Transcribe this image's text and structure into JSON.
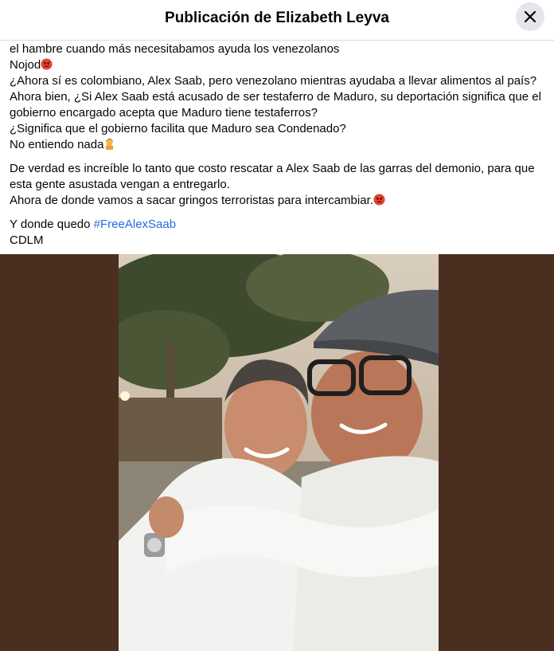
{
  "header": {
    "title": "Publicación de Elizabeth Leyva",
    "close_icon": "close-icon"
  },
  "post": {
    "lines1": [
      "el hambre cuando más necesitabamos ayuda los venezolanos",
      "Nojod",
      "¿Ahora sí es colombiano, Alex Saab, pero venezolano mientras ayudaba a llevar alimentos al país?",
      "Ahora bien, ¿Si Alex Saab está acusado de ser testaferro de Maduro, su deportación significa que el gobierno encargado acepta que Maduro tiene testaferros?",
      "¿Significa que el gobierno facilita que Maduro sea Condenado?",
      "No entiendo nada"
    ],
    "lines2": [
      "De verdad es increíble lo tanto que costo rescatar a Alex Saab de las garras del demonio, para que esta gente asustada vengan a entregarlo.",
      "Ahora de donde vamos a sacar gringos terroristas para intercambiar."
    ],
    "closing_prefix": "Y donde quedo ",
    "hashtag": "#FreeAlexSaab",
    "signature": "CDLM",
    "emojis": {
      "angry": "angry-face-emoji",
      "facepalm": "person-facepalming-emoji"
    }
  },
  "photo": {
    "description_icon": "post-photo-image"
  },
  "colors": {
    "hashtag": "#216fdb",
    "photo_background": "#4a2e1f",
    "close_button": "#e4e6eb"
  }
}
